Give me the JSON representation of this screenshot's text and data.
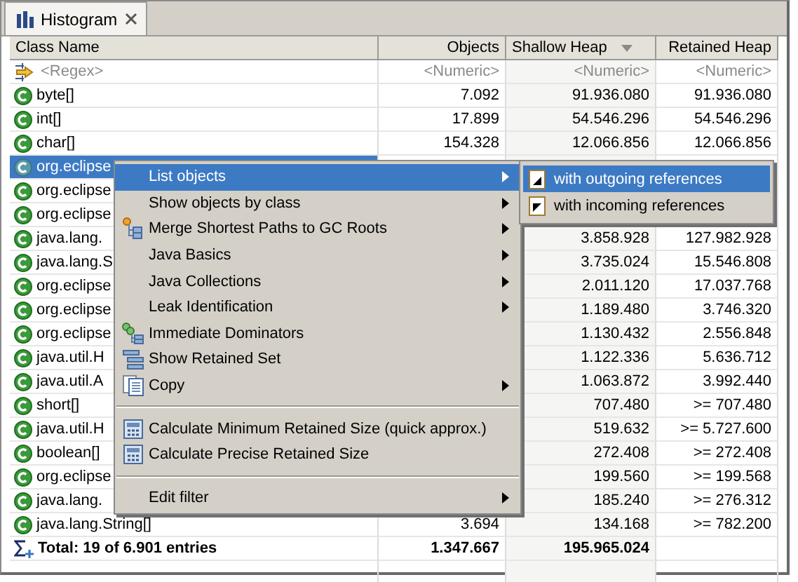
{
  "tab": {
    "title": "Histogram",
    "selected": true
  },
  "columns": [
    {
      "label": "Class Name",
      "sorted": false
    },
    {
      "label": "Objects",
      "sorted": false
    },
    {
      "label": "Shallow Heap",
      "sorted": true
    },
    {
      "label": "Retained Heap",
      "sorted": false
    }
  ],
  "filter_row": {
    "name": "<Regex>",
    "objects": "<Numeric>",
    "shallow": "<Numeric>",
    "retained": "<Numeric>"
  },
  "rows": [
    {
      "name": "byte[]",
      "objects": "7.092",
      "shallow": "91.936.080",
      "retained": "91.936.080",
      "selected": false
    },
    {
      "name": "int[]",
      "objects": "17.899",
      "shallow": "54.546.296",
      "retained": "54.546.296",
      "selected": false
    },
    {
      "name": "char[]",
      "objects": "154.328",
      "shallow": "12.066.856",
      "retained": "12.066.856",
      "selected": false
    },
    {
      "name": "org.eclipse",
      "selected": true
    },
    {
      "name": "org.eclipse",
      "selected": false
    },
    {
      "name": "org.eclipse",
      "selected": false
    },
    {
      "name": "java.lang.",
      "shallow": "3.858.928",
      "retained": "127.982.928",
      "selected": false
    },
    {
      "name": "java.lang.S",
      "shallow": "3.735.024",
      "retained": "15.546.808",
      "selected": false
    },
    {
      "name": "org.eclipse",
      "shallow": "2.011.120",
      "retained": "17.037.768",
      "selected": false
    },
    {
      "name": "org.eclipse",
      "shallow": "1.189.480",
      "retained": "3.746.320",
      "selected": false
    },
    {
      "name": "org.eclipse",
      "shallow": "1.130.432",
      "retained": "2.556.848",
      "selected": false
    },
    {
      "name": "java.util.H",
      "shallow": "1.122.336",
      "retained": "5.636.712",
      "selected": false
    },
    {
      "name": "java.util.A",
      "shallow": "1.063.872",
      "retained": "3.992.440",
      "selected": false
    },
    {
      "name": "short[]",
      "shallow": "707.480",
      "retained": ">= 707.480",
      "selected": false
    },
    {
      "name": "java.util.H",
      "shallow": "519.632",
      "retained": ">= 5.727.600",
      "selected": false
    },
    {
      "name": "boolean[]",
      "shallow": "272.408",
      "retained": ">= 272.408",
      "selected": false
    },
    {
      "name": "org.eclipse",
      "shallow": "199.560",
      "retained": ">= 199.568",
      "selected": false
    },
    {
      "name": "java.lang.",
      "shallow": "185.240",
      "retained": ">= 276.312",
      "selected": false
    },
    {
      "name": "java.lang.String[]",
      "objects": "3.694",
      "shallow": "134.168",
      "retained": ">= 782.200",
      "selected": false
    }
  ],
  "total": {
    "label": "Total: 19 of 6.901 entries",
    "objects": "1.347.667",
    "shallow": "195.965.024"
  },
  "context_menu": [
    {
      "kind": "item",
      "label": "List objects",
      "submenu": true,
      "selected": true
    },
    {
      "kind": "item",
      "label": "Show objects by class",
      "submenu": true,
      "selected": false
    },
    {
      "kind": "item",
      "label": "Merge Shortest Paths to GC Roots",
      "submenu": true,
      "selected": false
    },
    {
      "kind": "item",
      "label": "Java Basics",
      "submenu": true,
      "selected": false
    },
    {
      "kind": "item",
      "label": "Java Collections",
      "submenu": true,
      "selected": false
    },
    {
      "kind": "item",
      "label": "Leak Identification",
      "submenu": true,
      "selected": false
    },
    {
      "kind": "item",
      "label": "Immediate Dominators",
      "submenu": false,
      "selected": false
    },
    {
      "kind": "item",
      "label": "Show Retained Set",
      "submenu": false,
      "selected": false
    },
    {
      "kind": "item",
      "label": "Copy",
      "submenu": true,
      "selected": false
    },
    {
      "kind": "separator"
    },
    {
      "kind": "item",
      "label": "Calculate Minimum Retained Size (quick approx.)",
      "submenu": false,
      "selected": false
    },
    {
      "kind": "item",
      "label": "Calculate Precise Retained Size",
      "submenu": false,
      "selected": false
    },
    {
      "kind": "separator"
    },
    {
      "kind": "item",
      "label": "Edit filter",
      "submenu": true,
      "selected": false
    }
  ],
  "submenu": [
    {
      "label": "with outgoing references",
      "selected": true
    },
    {
      "label": "with incoming references",
      "selected": false
    }
  ]
}
